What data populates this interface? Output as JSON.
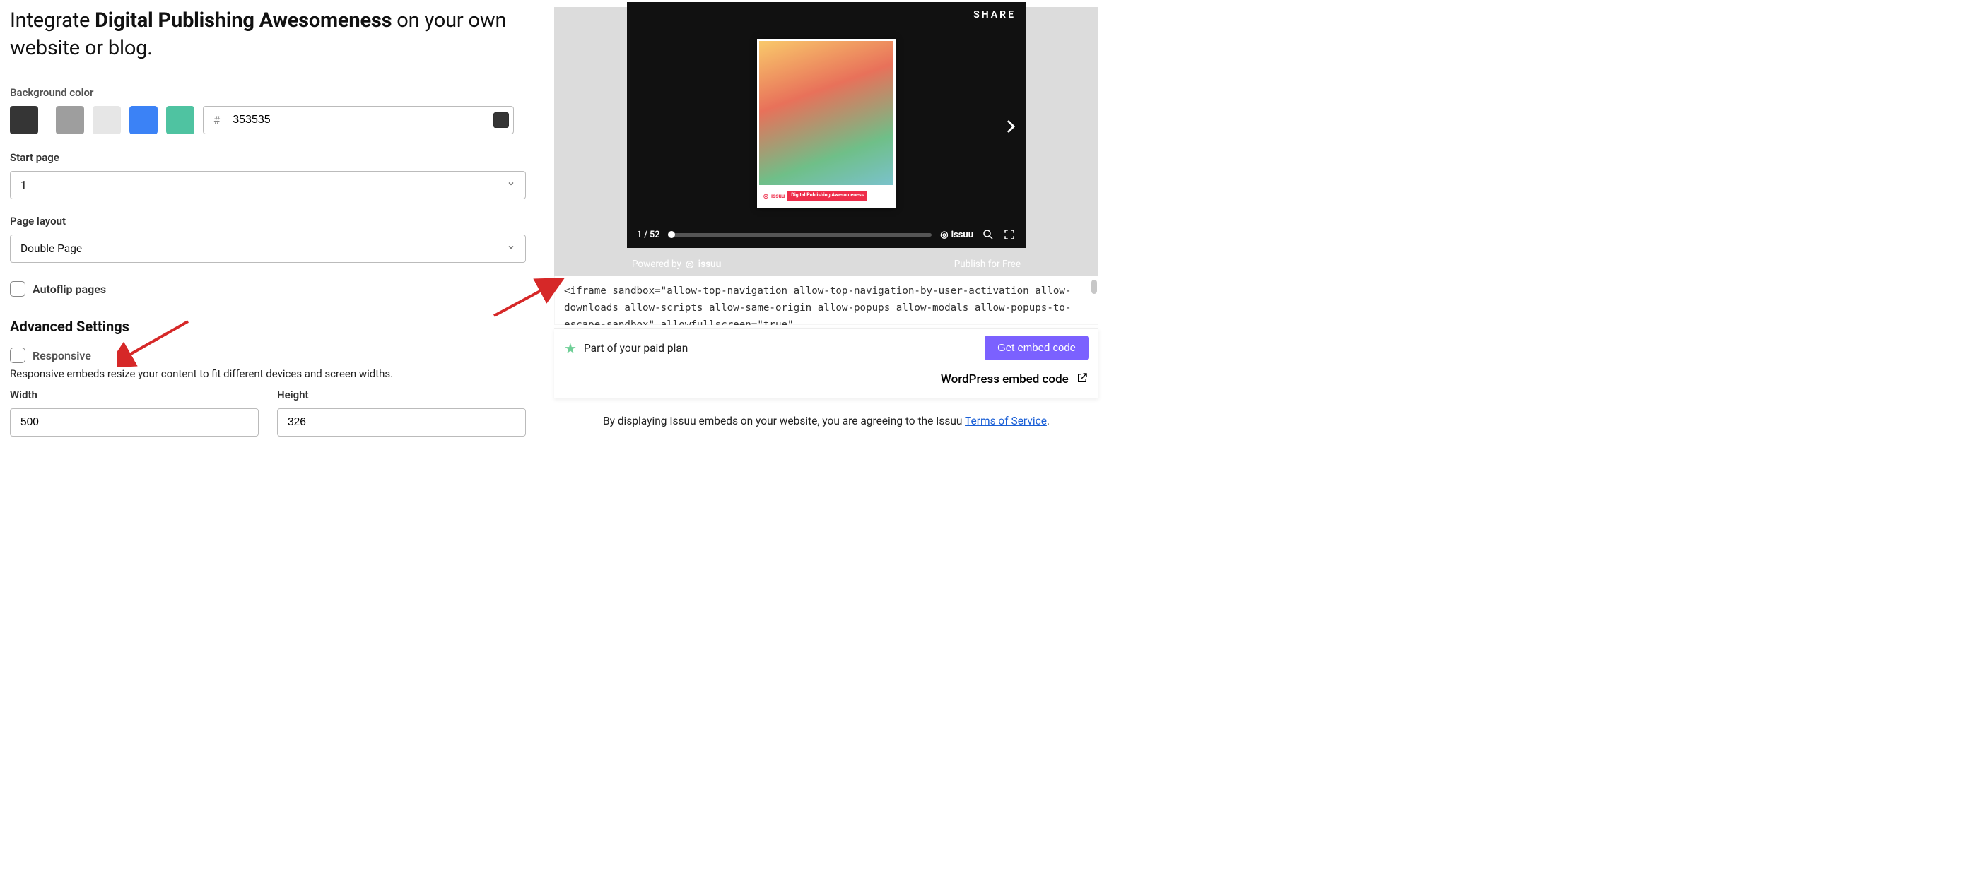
{
  "headline": {
    "prefix": "Integrate ",
    "title": "Digital Publishing Awesomeness",
    "suffix": " on your own website or blog."
  },
  "bg": {
    "label": "Background color",
    "swatches": [
      "#353535",
      "#9e9e9e",
      "#e6e6e6",
      "#3b82f6",
      "#4fc3a1"
    ],
    "hash": "#",
    "value": "353535",
    "preview": "#353535"
  },
  "startpage": {
    "label": "Start page",
    "value": "1"
  },
  "layout": {
    "label": "Page layout",
    "value": "Double Page"
  },
  "autoflip": {
    "label": "Autoflip pages"
  },
  "advanced": {
    "heading": "Advanced Settings"
  },
  "responsive": {
    "label": "Responsive",
    "hint": "Responsive embeds resize your content to fit different devices and screen widths."
  },
  "width": {
    "label": "Width",
    "value": "500"
  },
  "height": {
    "label": "Height",
    "value": "326"
  },
  "player": {
    "share": "SHARE",
    "pager": "1 / 52",
    "brand": "issuu",
    "cover_brand": "issuu",
    "cover_tag": "Digital Publishing Awesomeness",
    "powered": "Powered by",
    "publish": "Publish for Free"
  },
  "embed_code": "<iframe sandbox=\"allow-top-navigation allow-top-navigation-by-user-activation allow-downloads allow-scripts allow-same-origin allow-popups allow-modals allow-popups-to-escape-sandbox\" allowfullscreen=\"true\"",
  "plan": {
    "text": "Part of your paid plan"
  },
  "buttons": {
    "get_embed": "Get embed code",
    "wp": "WordPress embed code"
  },
  "tos": {
    "text": "By displaying Issuu embeds on your website, you are agreeing to the Issuu ",
    "link": "Terms of Service",
    "suffix": "."
  }
}
